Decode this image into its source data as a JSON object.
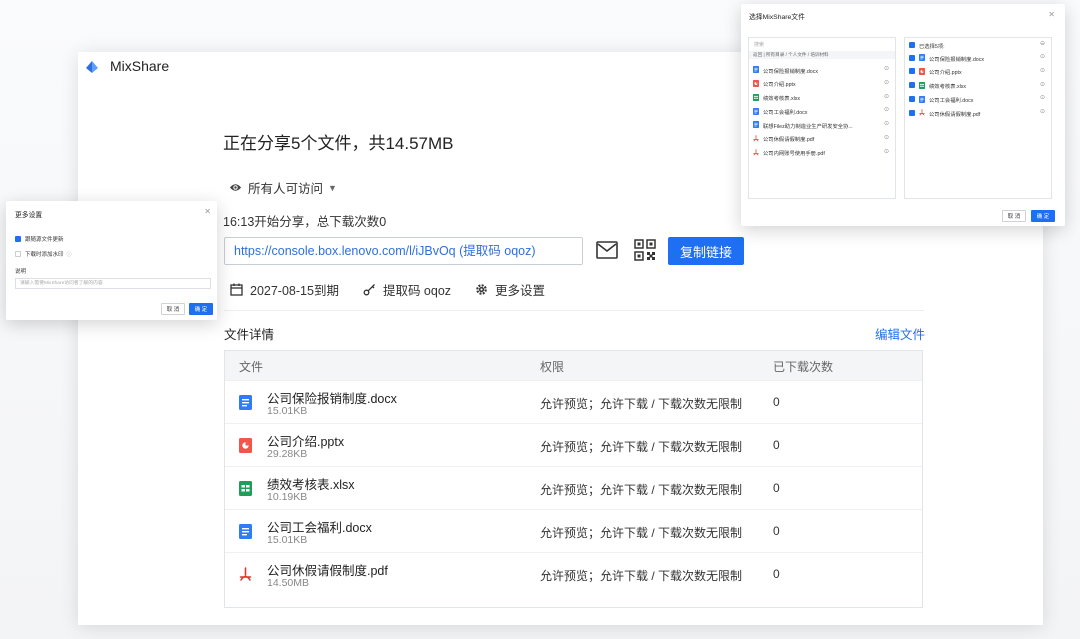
{
  "app": {
    "name": "MixShare"
  },
  "share": {
    "title": "正在分享5个文件，共14.57MB",
    "access_label": "所有人可访问",
    "info": "16:13开始分享，总下载次数0",
    "link": "https://console.box.lenovo.com/l/iJBvOq (提取码 oqoz)",
    "copy_label": "复制链接",
    "expire": "2027-08-15到期",
    "code": "提取码 oqoz",
    "more_settings": "更多设置"
  },
  "files": {
    "section_title": "文件详情",
    "edit_label": "编辑文件",
    "columns": {
      "file": "文件",
      "permission": "权限",
      "downloads": "已下载次数"
    },
    "rows": [
      {
        "name": "公司保险报销制度.docx",
        "size": "15.01KB",
        "permission": "允许预览；允许下载 / 下载次数无限制",
        "downloads": "0",
        "type": "doc"
      },
      {
        "name": "公司介绍.pptx",
        "size": "29.28KB",
        "permission": "允许预览；允许下载 / 下载次数无限制",
        "downloads": "0",
        "type": "ppt"
      },
      {
        "name": "绩效考核表.xlsx",
        "size": "10.19KB",
        "permission": "允许预览；允许下载 / 下载次数无限制",
        "downloads": "0",
        "type": "xls"
      },
      {
        "name": "公司工会福利.docx",
        "size": "15.01KB",
        "permission": "允许预览；允许下载 / 下载次数无限制",
        "downloads": "0",
        "type": "doc"
      },
      {
        "name": "公司休假请假制度.pdf",
        "size": "14.50MB",
        "permission": "允许预览；允许下载 / 下载次数无限制",
        "downloads": "0",
        "type": "pdf"
      }
    ]
  },
  "picker": {
    "title": "选择MixShare文件",
    "search_placeholder": "搜索",
    "breadcrumb": "返回 | 所有目录 / 个人文件 / 培训材料",
    "selected_header": "已选择5项:",
    "left_items": [
      {
        "label": "公司保险报销制度.docx",
        "type": "doc"
      },
      {
        "label": "公司介绍.pptx",
        "type": "ppt"
      },
      {
        "label": "绩效考核表.xlsx",
        "type": "xls"
      },
      {
        "label": "公司工会福利.docx",
        "type": "doc"
      },
      {
        "label": "联想Filez助力制造业生产研发安全协...",
        "type": "doc2"
      },
      {
        "label": "公司休假请假制度.pdf",
        "type": "pdf"
      },
      {
        "label": "公司内网账号使用手册.pdf",
        "type": "pdf"
      }
    ],
    "right_items": [
      {
        "label": "公司保险报销制度.docx",
        "type": "doc"
      },
      {
        "label": "公司介绍.pptx",
        "type": "ppt"
      },
      {
        "label": "绩效考核表.xlsx",
        "type": "xls"
      },
      {
        "label": "公司工会福利.docx",
        "type": "doc"
      },
      {
        "label": "公司休假请假制度.pdf",
        "type": "pdf"
      }
    ],
    "cancel_label": "取 消",
    "ok_label": "确 定"
  },
  "settings": {
    "title": "更多设置",
    "option_follow": "跟随源文件更新",
    "option_watermark": "下载时添加水印",
    "desc_label": "说明",
    "desc_placeholder": "请输入需要MixShare访问者了解的内容",
    "cancel_label": "取 消",
    "ok_label": "确 定"
  },
  "colors": {
    "accent": "#1f6ff2",
    "doc": "#2f7cf6",
    "ppt": "#f2564b",
    "xls": "#1d9f5a",
    "pdf": "#e8342a"
  }
}
